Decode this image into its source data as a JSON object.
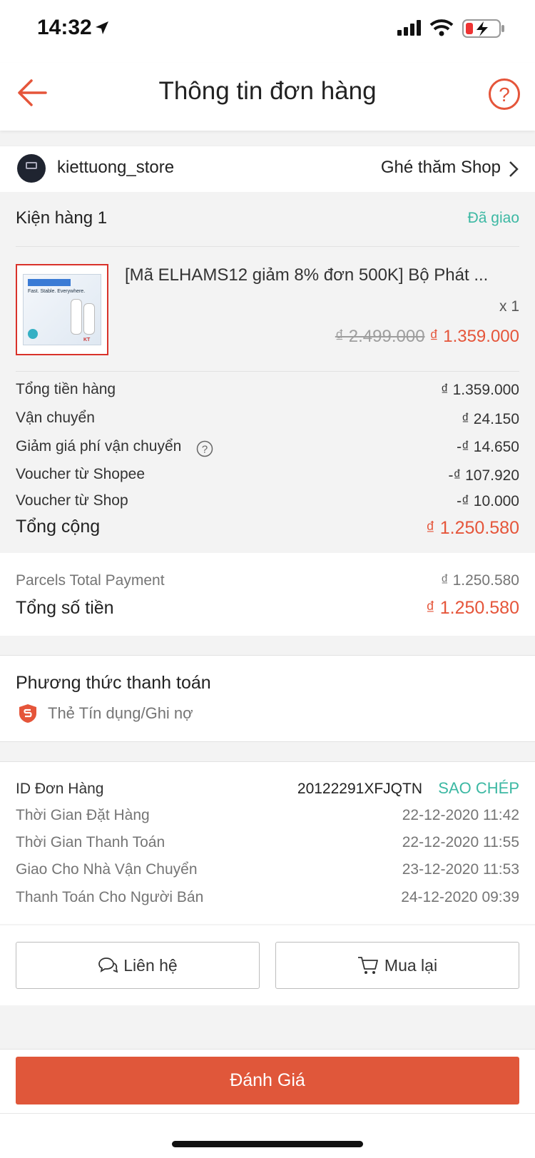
{
  "status_bar": {
    "time": "14:32"
  },
  "header": {
    "title": "Thông tin đơn hàng"
  },
  "shop": {
    "name": "kiettuong_store",
    "visit_label": "Ghé thăm Shop"
  },
  "parcel": {
    "title": "Kiện hàng 1",
    "status": "Đã giao",
    "product_name": "[Mã ELHAMS12 giảm 8% đơn 500K] Bộ Phát ...",
    "quantity": "x 1",
    "original_price": "₫ 2.499.000",
    "price": "₫ 1.359.000"
  },
  "summary": {
    "rows": [
      {
        "label": "Tổng tiền hàng",
        "value": "₫ 1.359.000"
      },
      {
        "label": "Vận chuyển",
        "value": "₫ 24.150"
      },
      {
        "label": "Giảm giá phí vận chuyển",
        "value": "-₫ 14.650"
      },
      {
        "label": "Voucher từ Shopee",
        "value": "-₫ 107.920"
      },
      {
        "label": "Voucher từ Shop",
        "value": "-₫ 10.000"
      }
    ],
    "total_label": "Tổng cộng",
    "total_value": "₫ 1.250.580"
  },
  "payment_totals": {
    "parcels_label": "Parcels Total Payment",
    "parcels_value": "₫ 1.250.580",
    "total_label": "Tổng số tiền",
    "total_value": "₫ 1.250.580"
  },
  "payment_method": {
    "title": "Phương thức thanh toán",
    "method": "Thẻ Tín dụng/Ghi nợ"
  },
  "order_info": {
    "id_label": "ID Đơn Hàng",
    "id_value": "20122291XFJQTN",
    "copy_label": "SAO CHÉP",
    "rows": [
      {
        "label": "Thời Gian Đặt Hàng",
        "value": "22-12-2020 11:42"
      },
      {
        "label": "Thời Gian Thanh Toán",
        "value": "22-12-2020 11:55"
      },
      {
        "label": "Giao Cho Nhà Vận Chuyển",
        "value": "23-12-2020 11:53"
      },
      {
        "label": "Thanh Toán Cho Người Bán",
        "value": "24-12-2020 09:39"
      }
    ]
  },
  "actions": {
    "contact_label": "Liên hệ",
    "buy_again_label": "Mua lại",
    "rate_label": "Đánh Giá"
  },
  "product_image": {
    "box_text": "Fast. Stable. Everywhere.",
    "brand": "deco"
  },
  "colors": {
    "accent": "#e5553a",
    "teal": "#3cb8a3"
  }
}
